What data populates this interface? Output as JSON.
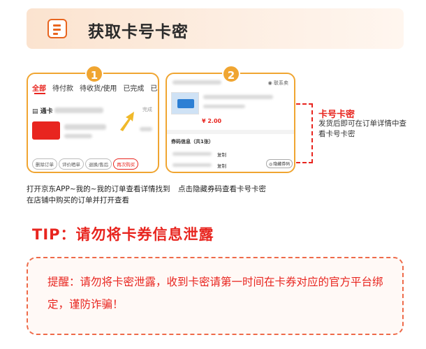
{
  "header": {
    "title": "获取卡号卡密",
    "icon": "document-list-icon"
  },
  "step1": {
    "number": "1",
    "tabs": [
      "全部",
      "待付款",
      "待收货/使用",
      "已完成",
      "已取"
    ],
    "shop_prefix": "通卡",
    "status": "完成",
    "buttons": [
      "删除订单",
      "评价晒单",
      "退换/售后",
      "再次购买"
    ]
  },
  "step2": {
    "number": "2",
    "more": "联系卖",
    "price": "¥ 2.00",
    "section_title": "券码信息（共1张）",
    "copy_label": "复制",
    "hide_button": "隐藏券码"
  },
  "callout": {
    "title": "卡号卡密",
    "desc": "发货后即可在订单详情中查看卡号卡密"
  },
  "captions": {
    "step1": "打开京东APP~我的~我的订单查看详情找到在店铺中购买的订单并打开查看",
    "step2": "点击隐藏券码查看卡号卡密"
  },
  "tip": "TIP：请勿将卡券信息泄露",
  "warning": "提醒：请勿将卡密泄露，收到卡密请第一时间在卡券对应的官方平台绑定，谨防诈骗！",
  "colors": {
    "accent": "#e8251f",
    "highlight": "#f0a531",
    "header_bg": "#fbe3cf"
  }
}
